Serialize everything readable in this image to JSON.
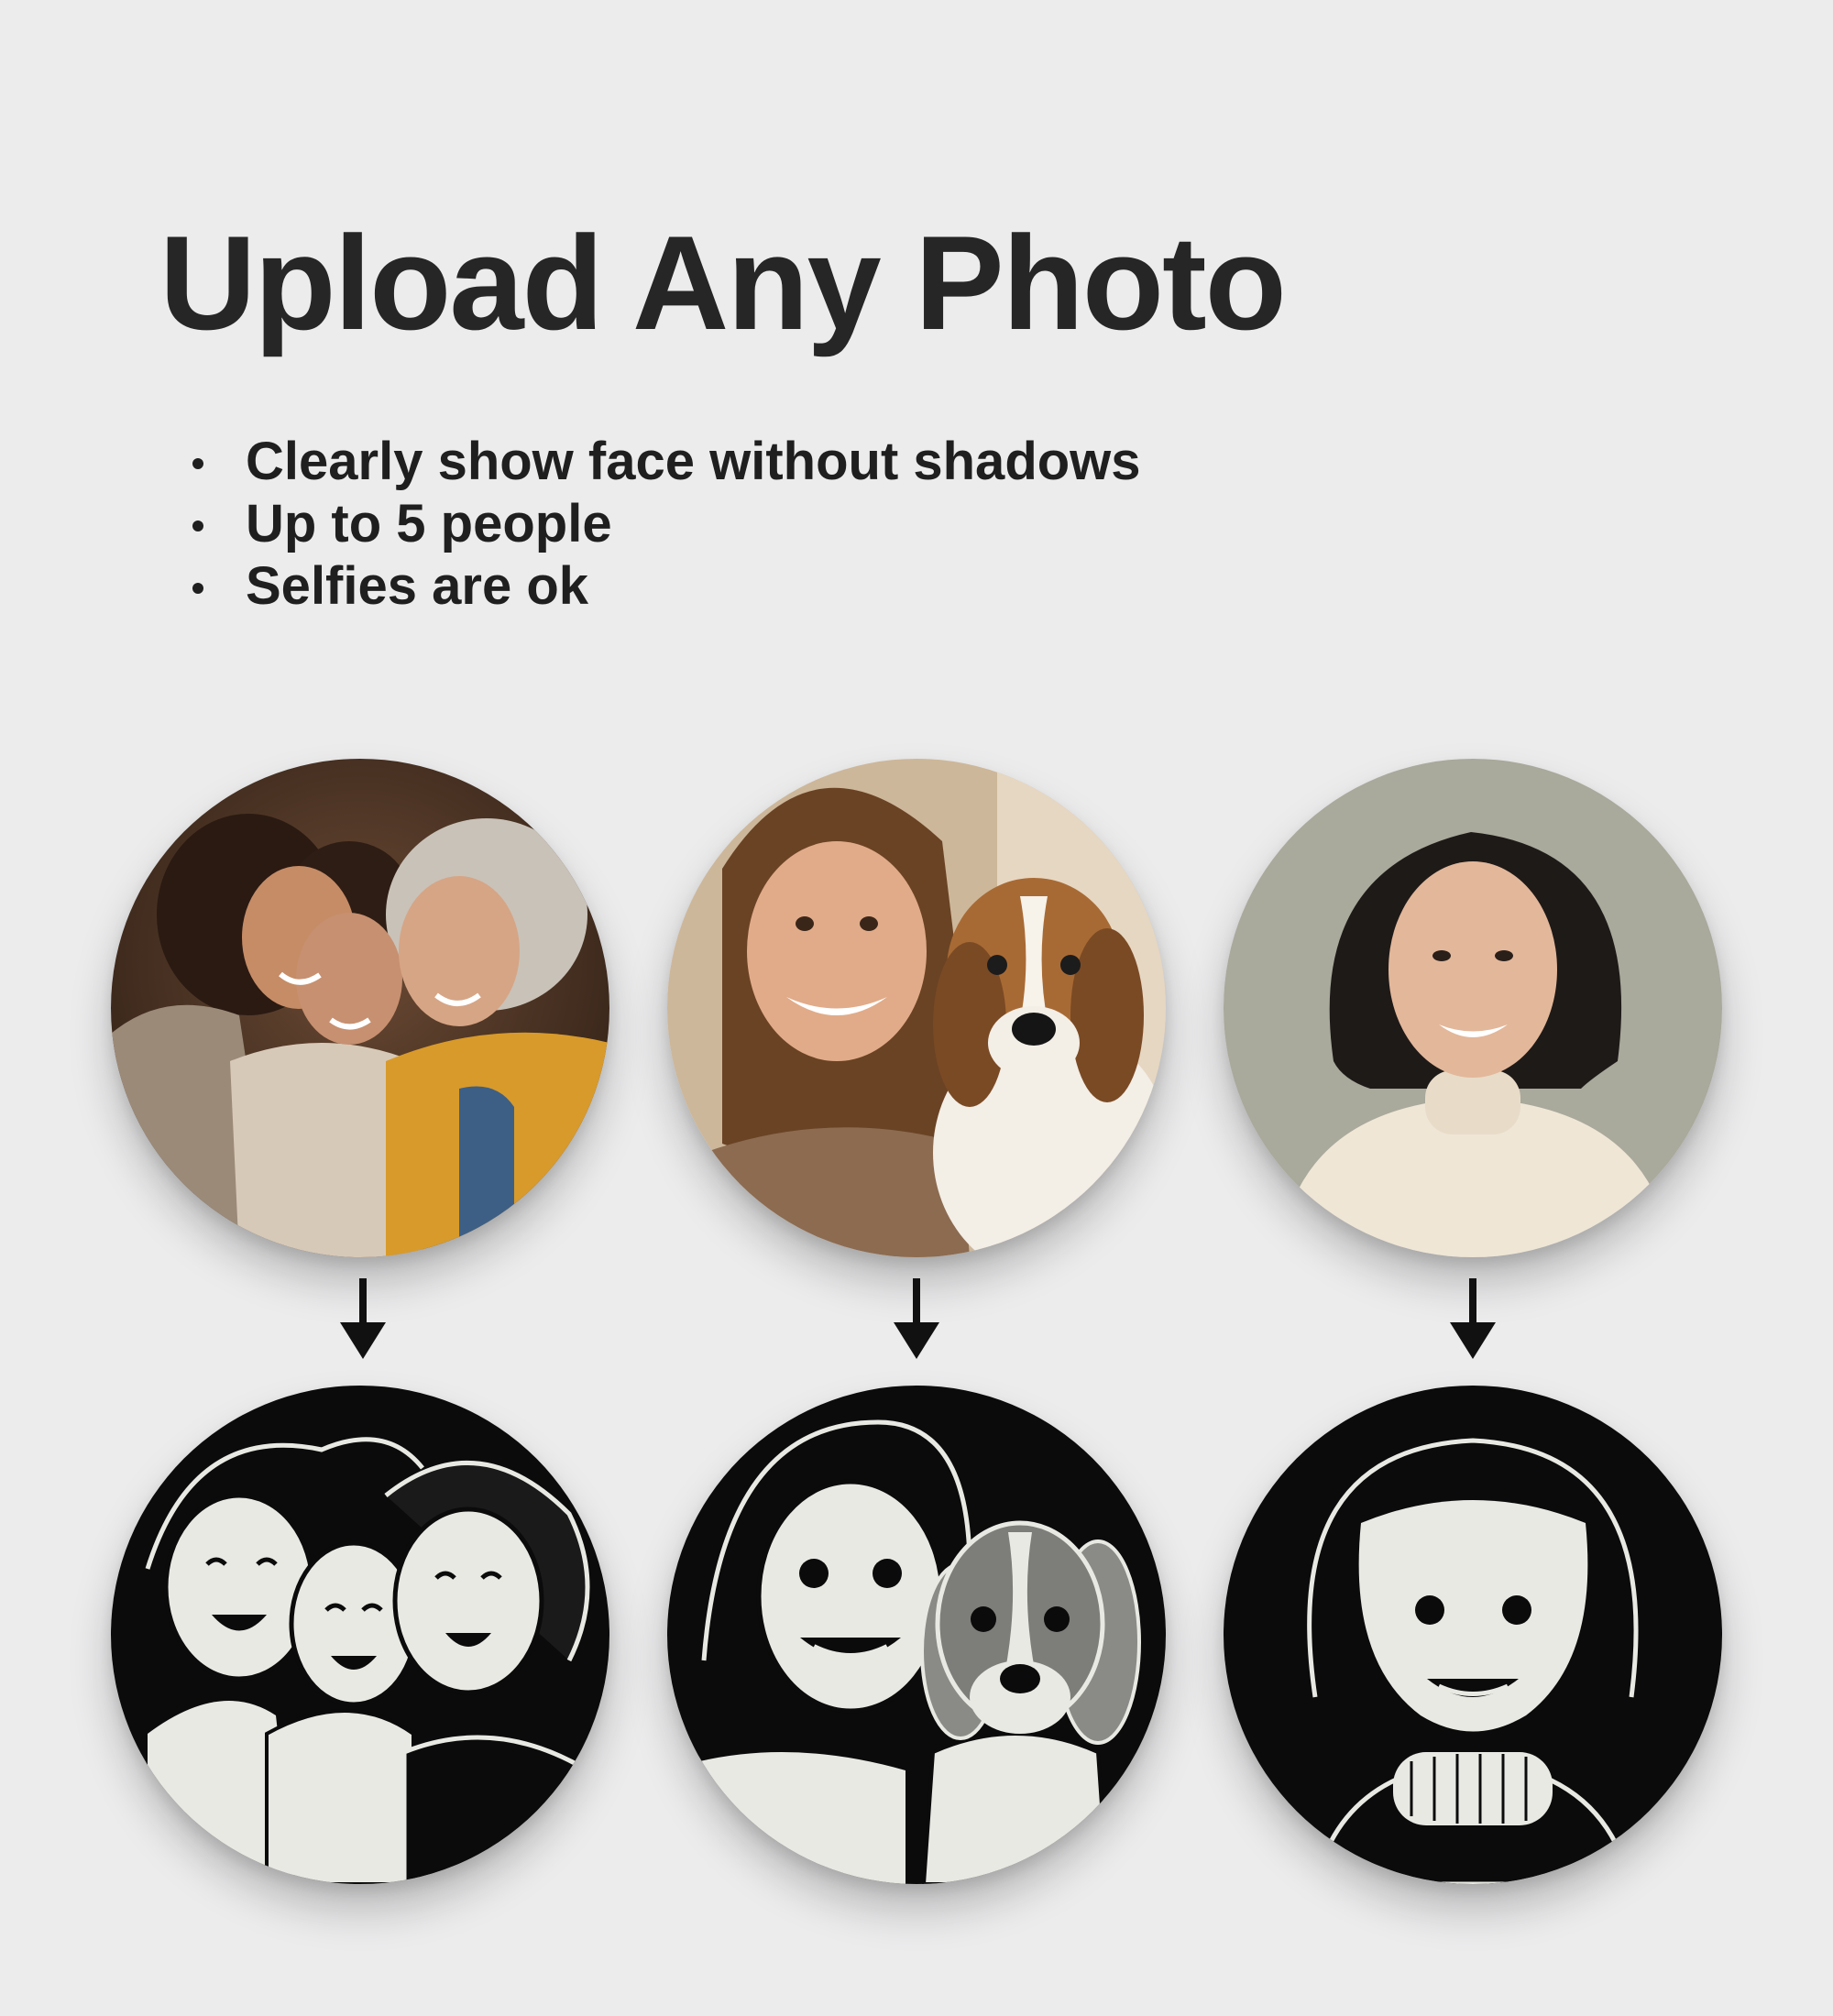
{
  "heading": {
    "title": "Upload Any Photo"
  },
  "tips": [
    "Clearly show face without shadows",
    "Up to 5 people",
    "Selfies are ok"
  ],
  "examples": [
    {
      "photo_icon": "family-three-women-photo",
      "result_icon": "family-three-women-illustration"
    },
    {
      "photo_icon": "woman-with-beagle-photo",
      "result_icon": "woman-with-beagle-illustration"
    },
    {
      "photo_icon": "woman-portrait-photo",
      "result_icon": "woman-portrait-illustration"
    }
  ],
  "colors": {
    "background": "#ececed",
    "title": "#262626",
    "illustration_dark": "#0b0b0b",
    "illustration_light": "#e9e9e4"
  }
}
